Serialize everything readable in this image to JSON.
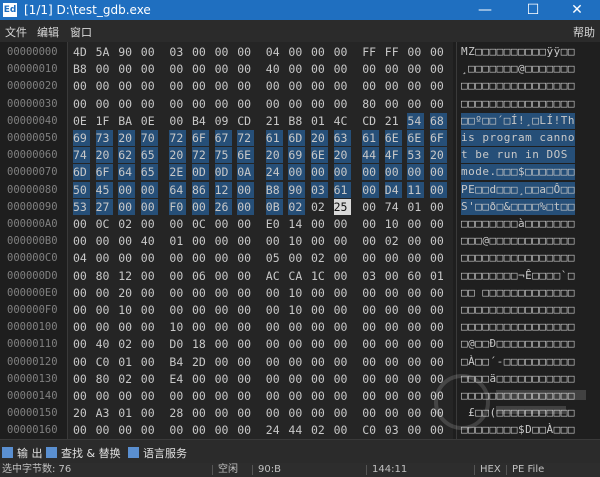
{
  "window": {
    "title": "[1/1] D:\\test_gdb.exe",
    "app_icon": "Ed",
    "min": "—",
    "max": "☐",
    "close": "✕"
  },
  "menu": {
    "file": "文件",
    "edit": "编辑",
    "window": "窗口",
    "help": "帮助"
  },
  "rows": [
    {
      "addr": "00000000",
      "hex": [
        "4D",
        "5A",
        "90",
        "00",
        "03",
        "00",
        "00",
        "00",
        "04",
        "00",
        "00",
        "00",
        "FF",
        "FF",
        "00",
        "00"
      ],
      "ascii": "MZ□□□□□□□□□□ÿÿ□□"
    },
    {
      "addr": "00000010",
      "hex": [
        "B8",
        "00",
        "00",
        "00",
        "00",
        "00",
        "00",
        "00",
        "40",
        "00",
        "00",
        "00",
        "00",
        "00",
        "00",
        "00"
      ],
      "ascii": "¸□□□□□□□@□□□□□□□"
    },
    {
      "addr": "00000020",
      "hex": [
        "00",
        "00",
        "00",
        "00",
        "00",
        "00",
        "00",
        "00",
        "00",
        "00",
        "00",
        "00",
        "00",
        "00",
        "00",
        "00"
      ],
      "ascii": "□□□□□□□□□□□□□□□□"
    },
    {
      "addr": "00000030",
      "hex": [
        "00",
        "00",
        "00",
        "00",
        "00",
        "00",
        "00",
        "00",
        "00",
        "00",
        "00",
        "00",
        "80",
        "00",
        "00",
        "00"
      ],
      "ascii": "□□□□□□□□□□□□□□□□"
    },
    {
      "addr": "00000040",
      "hex": [
        "0E",
        "1F",
        "BA",
        "0E",
        "00",
        "B4",
        "09",
        "CD",
        "21",
        "B8",
        "01",
        "4C",
        "CD",
        "21",
        "54",
        "68"
      ],
      "ascii": "□□º□□´□Í!¸□LÍ!Th"
    },
    {
      "addr": "00000050",
      "hex": [
        "69",
        "73",
        "20",
        "70",
        "72",
        "6F",
        "67",
        "72",
        "61",
        "6D",
        "20",
        "63",
        "61",
        "6E",
        "6E",
        "6F"
      ],
      "ascii": "is program canno"
    },
    {
      "addr": "00000060",
      "hex": [
        "74",
        "20",
        "62",
        "65",
        "20",
        "72",
        "75",
        "6E",
        "20",
        "69",
        "6E",
        "20",
        "44",
        "4F",
        "53",
        "20"
      ],
      "ascii": "t be run in DOS "
    },
    {
      "addr": "00000070",
      "hex": [
        "6D",
        "6F",
        "64",
        "65",
        "2E",
        "0D",
        "0D",
        "0A",
        "24",
        "00",
        "00",
        "00",
        "00",
        "00",
        "00",
        "00"
      ],
      "ascii": "mode.□□□$□□□□□□□"
    },
    {
      "addr": "00000080",
      "hex": [
        "50",
        "45",
        "00",
        "00",
        "64",
        "86",
        "12",
        "00",
        "B8",
        "90",
        "03",
        "61",
        "00",
        "D4",
        "11",
        "00"
      ],
      "ascii": "PE□□d□□□¸□□a□Ô□□"
    },
    {
      "addr": "00000090",
      "hex": [
        "53",
        "27",
        "00",
        "00",
        "F0",
        "00",
        "26",
        "00",
        "0B",
        "02",
        "02",
        "25",
        "00",
        "74",
        "01",
        "00"
      ],
      "ascii": "S'□□ð□&□□□□%□t□□"
    },
    {
      "addr": "000000A0",
      "hex": [
        "00",
        "0C",
        "02",
        "00",
        "00",
        "0C",
        "00",
        "00",
        "E0",
        "14",
        "00",
        "00",
        "00",
        "10",
        "00",
        "00"
      ],
      "ascii": "□□□□□□□□à□□□□□□□"
    },
    {
      "addr": "000000B0",
      "hex": [
        "00",
        "00",
        "00",
        "40",
        "01",
        "00",
        "00",
        "00",
        "00",
        "10",
        "00",
        "00",
        "00",
        "02",
        "00",
        "00"
      ],
      "ascii": "□□□@□□□□□□□□□□□□"
    },
    {
      "addr": "000000C0",
      "hex": [
        "04",
        "00",
        "00",
        "00",
        "00",
        "00",
        "00",
        "00",
        "05",
        "00",
        "02",
        "00",
        "00",
        "00",
        "00",
        "00"
      ],
      "ascii": "□□□□□□□□□□□□□□□□"
    },
    {
      "addr": "000000D0",
      "hex": [
        "00",
        "80",
        "12",
        "00",
        "00",
        "06",
        "00",
        "00",
        "AC",
        "CA",
        "1C",
        "00",
        "03",
        "00",
        "60",
        "01"
      ],
      "ascii": "□□□□□□□□¬Ê□□□□`□"
    },
    {
      "addr": "000000E0",
      "hex": [
        "00",
        "00",
        "20",
        "00",
        "00",
        "00",
        "00",
        "00",
        "00",
        "10",
        "00",
        "00",
        "00",
        "00",
        "00",
        "00"
      ],
      "ascii": "□□ □□□□□□□□□□□□□"
    },
    {
      "addr": "000000F0",
      "hex": [
        "00",
        "00",
        "10",
        "00",
        "00",
        "00",
        "00",
        "00",
        "00",
        "10",
        "00",
        "00",
        "00",
        "00",
        "00",
        "00"
      ],
      "ascii": "□□□□□□□□□□□□□□□□"
    },
    {
      "addr": "00000100",
      "hex": [
        "00",
        "00",
        "00",
        "00",
        "10",
        "00",
        "00",
        "00",
        "00",
        "00",
        "00",
        "00",
        "00",
        "00",
        "00",
        "00"
      ],
      "ascii": "□□□□□□□□□□□□□□□□"
    },
    {
      "addr": "00000110",
      "hex": [
        "00",
        "40",
        "02",
        "00",
        "D0",
        "18",
        "00",
        "00",
        "00",
        "00",
        "00",
        "00",
        "00",
        "00",
        "00",
        "00"
      ],
      "ascii": "□@□□Ð□□□□□□□□□□□"
    },
    {
      "addr": "00000120",
      "hex": [
        "00",
        "C0",
        "01",
        "00",
        "B4",
        "2D",
        "00",
        "00",
        "00",
        "00",
        "00",
        "00",
        "00",
        "00",
        "00",
        "00"
      ],
      "ascii": "□À□□´-□□□□□□□□□□"
    },
    {
      "addr": "00000130",
      "hex": [
        "00",
        "80",
        "02",
        "00",
        "E4",
        "00",
        "00",
        "00",
        "00",
        "00",
        "00",
        "00",
        "00",
        "00",
        "00",
        "00"
      ],
      "ascii": "□□□□ä□□□□□□□□□□□"
    },
    {
      "addr": "00000140",
      "hex": [
        "00",
        "00",
        "00",
        "00",
        "00",
        "00",
        "00",
        "00",
        "00",
        "00",
        "00",
        "00",
        "00",
        "00",
        "00",
        "00"
      ],
      "ascii": "□□□□□□□□□□□□□□□□"
    },
    {
      "addr": "00000150",
      "hex": [
        "20",
        "A3",
        "01",
        "00",
        "28",
        "00",
        "00",
        "00",
        "00",
        "00",
        "00",
        "00",
        "00",
        "00",
        "00",
        "00"
      ],
      "ascii": " £□□(□□□□□□□□□□□"
    },
    {
      "addr": "00000160",
      "hex": [
        "00",
        "00",
        "00",
        "00",
        "00",
        "00",
        "00",
        "00",
        "24",
        "44",
        "02",
        "00",
        "C0",
        "03",
        "00",
        "00"
      ],
      "ascii": "□□□□□□□□$D□□À□□□"
    }
  ],
  "toolbar": {
    "output": "输 出",
    "find_replace": "查找 & 替换",
    "language_service": "语言服务"
  },
  "status": {
    "selected": "选中字节数: 76",
    "idle": "空闲",
    "position": "90:B",
    "column": "144:11",
    "mode": "HEX",
    "filetype": "PE File"
  }
}
